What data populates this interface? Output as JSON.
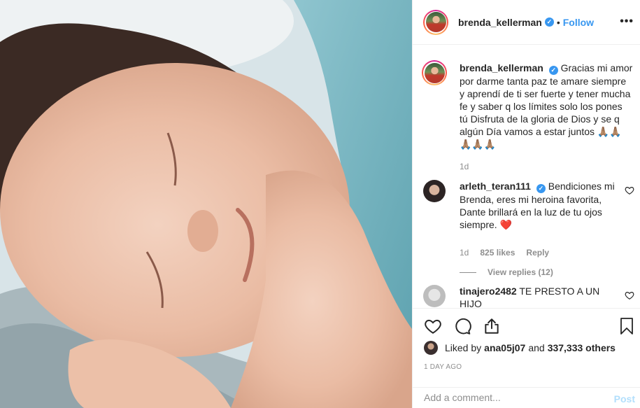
{
  "post": {
    "image_alt_name": "sleeping-newborn-photo"
  },
  "header": {
    "username": "brenda_kellerman",
    "dot": "•",
    "follow_label": "Follow",
    "more_label": "•••"
  },
  "caption": {
    "username": "brenda_kellerman",
    "text": "Gracias mi amor por darme tanta paz te amare siempre y aprendí de ti ser fuerte y tener mucha fe y saber q los límites solo los pones tú Disfruta de la gloria de Dios y se q algún Día vamos a estar juntos 🙏🏽🙏🏽🙏🏽🙏🏽🙏🏽",
    "time": "1d"
  },
  "comments": [
    {
      "username": "arleth_teran111",
      "verified": true,
      "text": "Bendiciones mi Brenda, eres mi heroina favorita, Dante brillará en la luz de tu ojos siempre. ❤️",
      "time": "1d",
      "likes": "825 likes",
      "reply_label": "Reply",
      "view_replies": "View replies (12)"
    },
    {
      "username": "tinajero2482",
      "verified": false,
      "text": "TE PRESTO A UN HIJO"
    }
  ],
  "likes": {
    "prefix": "Liked by ",
    "first_user": "ana05j07",
    "connector": " and ",
    "others": "337,333 others"
  },
  "timestamp": "1 DAY AGO",
  "add_comment": {
    "placeholder": "Add a comment...",
    "post_label": "Post"
  },
  "colors": {
    "link_blue": "#3897f0",
    "muted_gray": "#8e8e8e",
    "text": "#262626",
    "post_disabled": "#b2dffc"
  }
}
